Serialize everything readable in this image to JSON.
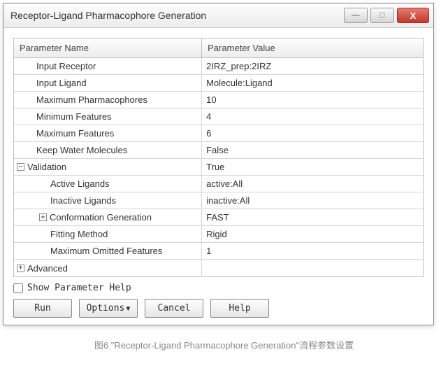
{
  "window": {
    "title": "Receptor-Ligand Pharmacophore Generation"
  },
  "table": {
    "header_name": "Parameter Name",
    "header_value": "Parameter Value",
    "rows": [
      {
        "name": "Input Receptor",
        "value": "2IRZ_prep:2IRZ"
      },
      {
        "name": "Input Ligand",
        "value": "Molecule:Ligand"
      },
      {
        "name": "Maximum Pharmacophores",
        "value": "10"
      },
      {
        "name": "Minimum Features",
        "value": "4"
      },
      {
        "name": "Maximum Features",
        "value": "6"
      },
      {
        "name": "Keep Water Molecules",
        "value": "False"
      },
      {
        "name": "Validation",
        "value": "True"
      },
      {
        "name": "Active Ligands",
        "value": "active:All"
      },
      {
        "name": "Inactive Ligands",
        "value": "inactive:All"
      },
      {
        "name": "Conformation Generation",
        "value": "FAST"
      },
      {
        "name": "Fitting Method",
        "value": "Rigid"
      },
      {
        "name": "Maximum Omitted Features",
        "value": "1"
      },
      {
        "name": "Advanced",
        "value": ""
      }
    ]
  },
  "help_checkbox_label": "Show Parameter Help",
  "buttons": {
    "run": "Run",
    "options": "Options",
    "cancel": "Cancel",
    "help": "Help"
  },
  "caption": "图6 \"Receptor-Ligand Pharmacophore Generation\"流程参数设置"
}
